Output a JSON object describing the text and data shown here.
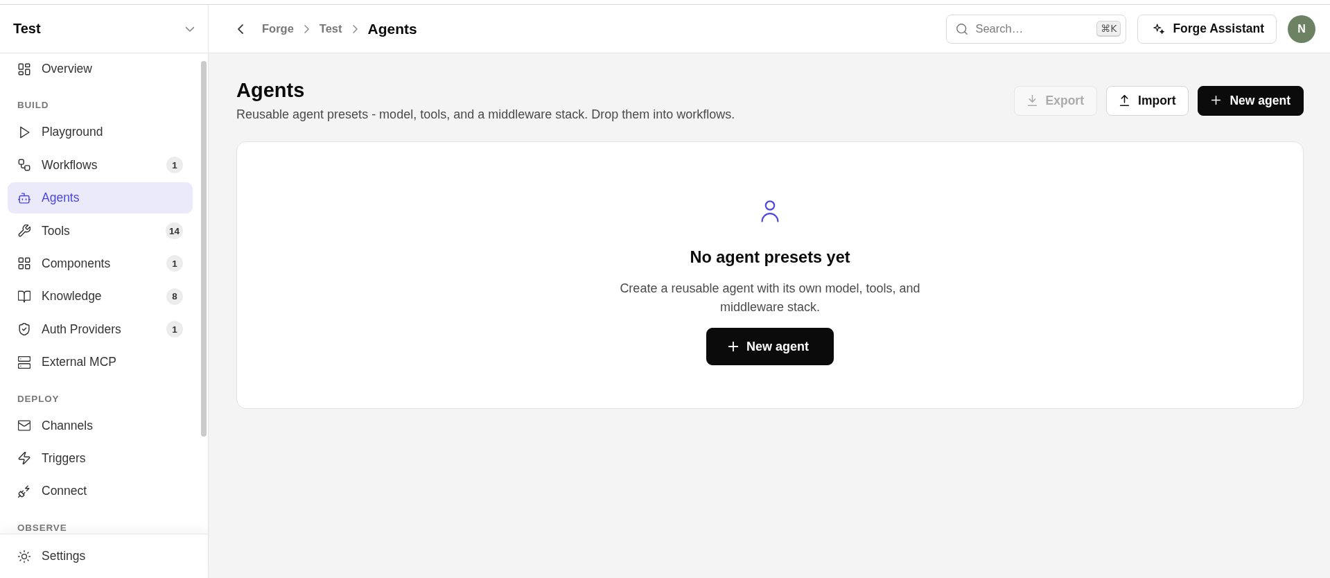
{
  "sidebar": {
    "workspace": "Test",
    "sections": [
      {
        "items": [
          {
            "label": "Overview",
            "selected": false
          }
        ]
      },
      {
        "heading": "BUILD",
        "items": [
          {
            "label": "Playground",
            "selected": false
          },
          {
            "label": "Workflows",
            "count": "1",
            "selected": false
          },
          {
            "label": "Agents",
            "selected": true
          },
          {
            "label": "Tools",
            "count": "14",
            "selected": false
          },
          {
            "label": "Components",
            "count": "1",
            "selected": false
          },
          {
            "label": "Knowledge",
            "count": "8",
            "selected": false
          },
          {
            "label": "Auth Providers",
            "count": "1",
            "selected": false
          },
          {
            "label": "External MCP",
            "selected": false
          }
        ]
      },
      {
        "heading": "DEPLOY",
        "items": [
          {
            "label": "Channels",
            "selected": false
          },
          {
            "label": "Triggers",
            "selected": false
          },
          {
            "label": "Connect",
            "selected": false
          }
        ]
      },
      {
        "heading": "OBSERVE"
      }
    ],
    "footer_item": {
      "label": "Settings",
      "selected": false
    }
  },
  "topbar": {
    "breadcrumbs": [
      {
        "label": "Forge",
        "current": false
      },
      {
        "label": "Test",
        "current": false
      },
      {
        "label": "Agents",
        "current": true
      }
    ],
    "search": {
      "placeholder": "Search…",
      "shortcut": "⌘K"
    },
    "assistant_button": "Forge Assistant",
    "avatar": "N"
  },
  "page": {
    "title": "Agents",
    "description": "Reusable agent presets - model, tools, and a middleware stack. Drop them into workflows.",
    "actions": [
      {
        "label": "Export",
        "kind": "secondary",
        "disabled": true
      },
      {
        "label": "Import",
        "kind": "secondary",
        "disabled": false
      },
      {
        "label": "New agent",
        "kind": "primary",
        "disabled": false
      }
    ]
  },
  "empty_state": {
    "title": "No agent presets yet",
    "description": "Create a reusable agent with its own model, tools, and middleware stack.",
    "button": "New agent"
  }
}
